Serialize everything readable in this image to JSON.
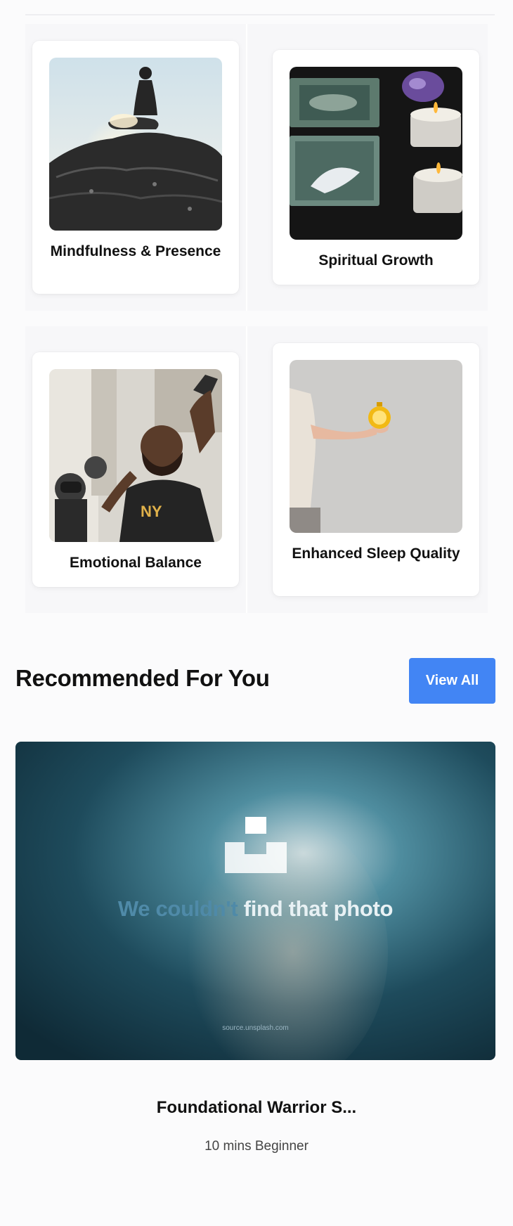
{
  "categories": [
    {
      "label": "Mindfulness & Presence",
      "image": "meditation-on-rock"
    },
    {
      "label": "Spiritual Growth",
      "image": "tarot-cards-candles"
    },
    {
      "label": "Emotional Balance",
      "image": "crowd-protest"
    },
    {
      "label": "Enhanced Sleep Quality",
      "image": "hand-holding-clock"
    }
  ],
  "recommended": {
    "section_title": "Recommended For You",
    "view_all_label": "View All",
    "placeholder": {
      "message_part1": "We couldn't",
      "message_part2": "find that photo",
      "source": "source.unsplash.com"
    },
    "item_title": "Foundational Warrior S...",
    "item_meta": "10 mins Beginner"
  },
  "colors": {
    "accent": "#4285f4",
    "background": "#fbfbfc"
  }
}
